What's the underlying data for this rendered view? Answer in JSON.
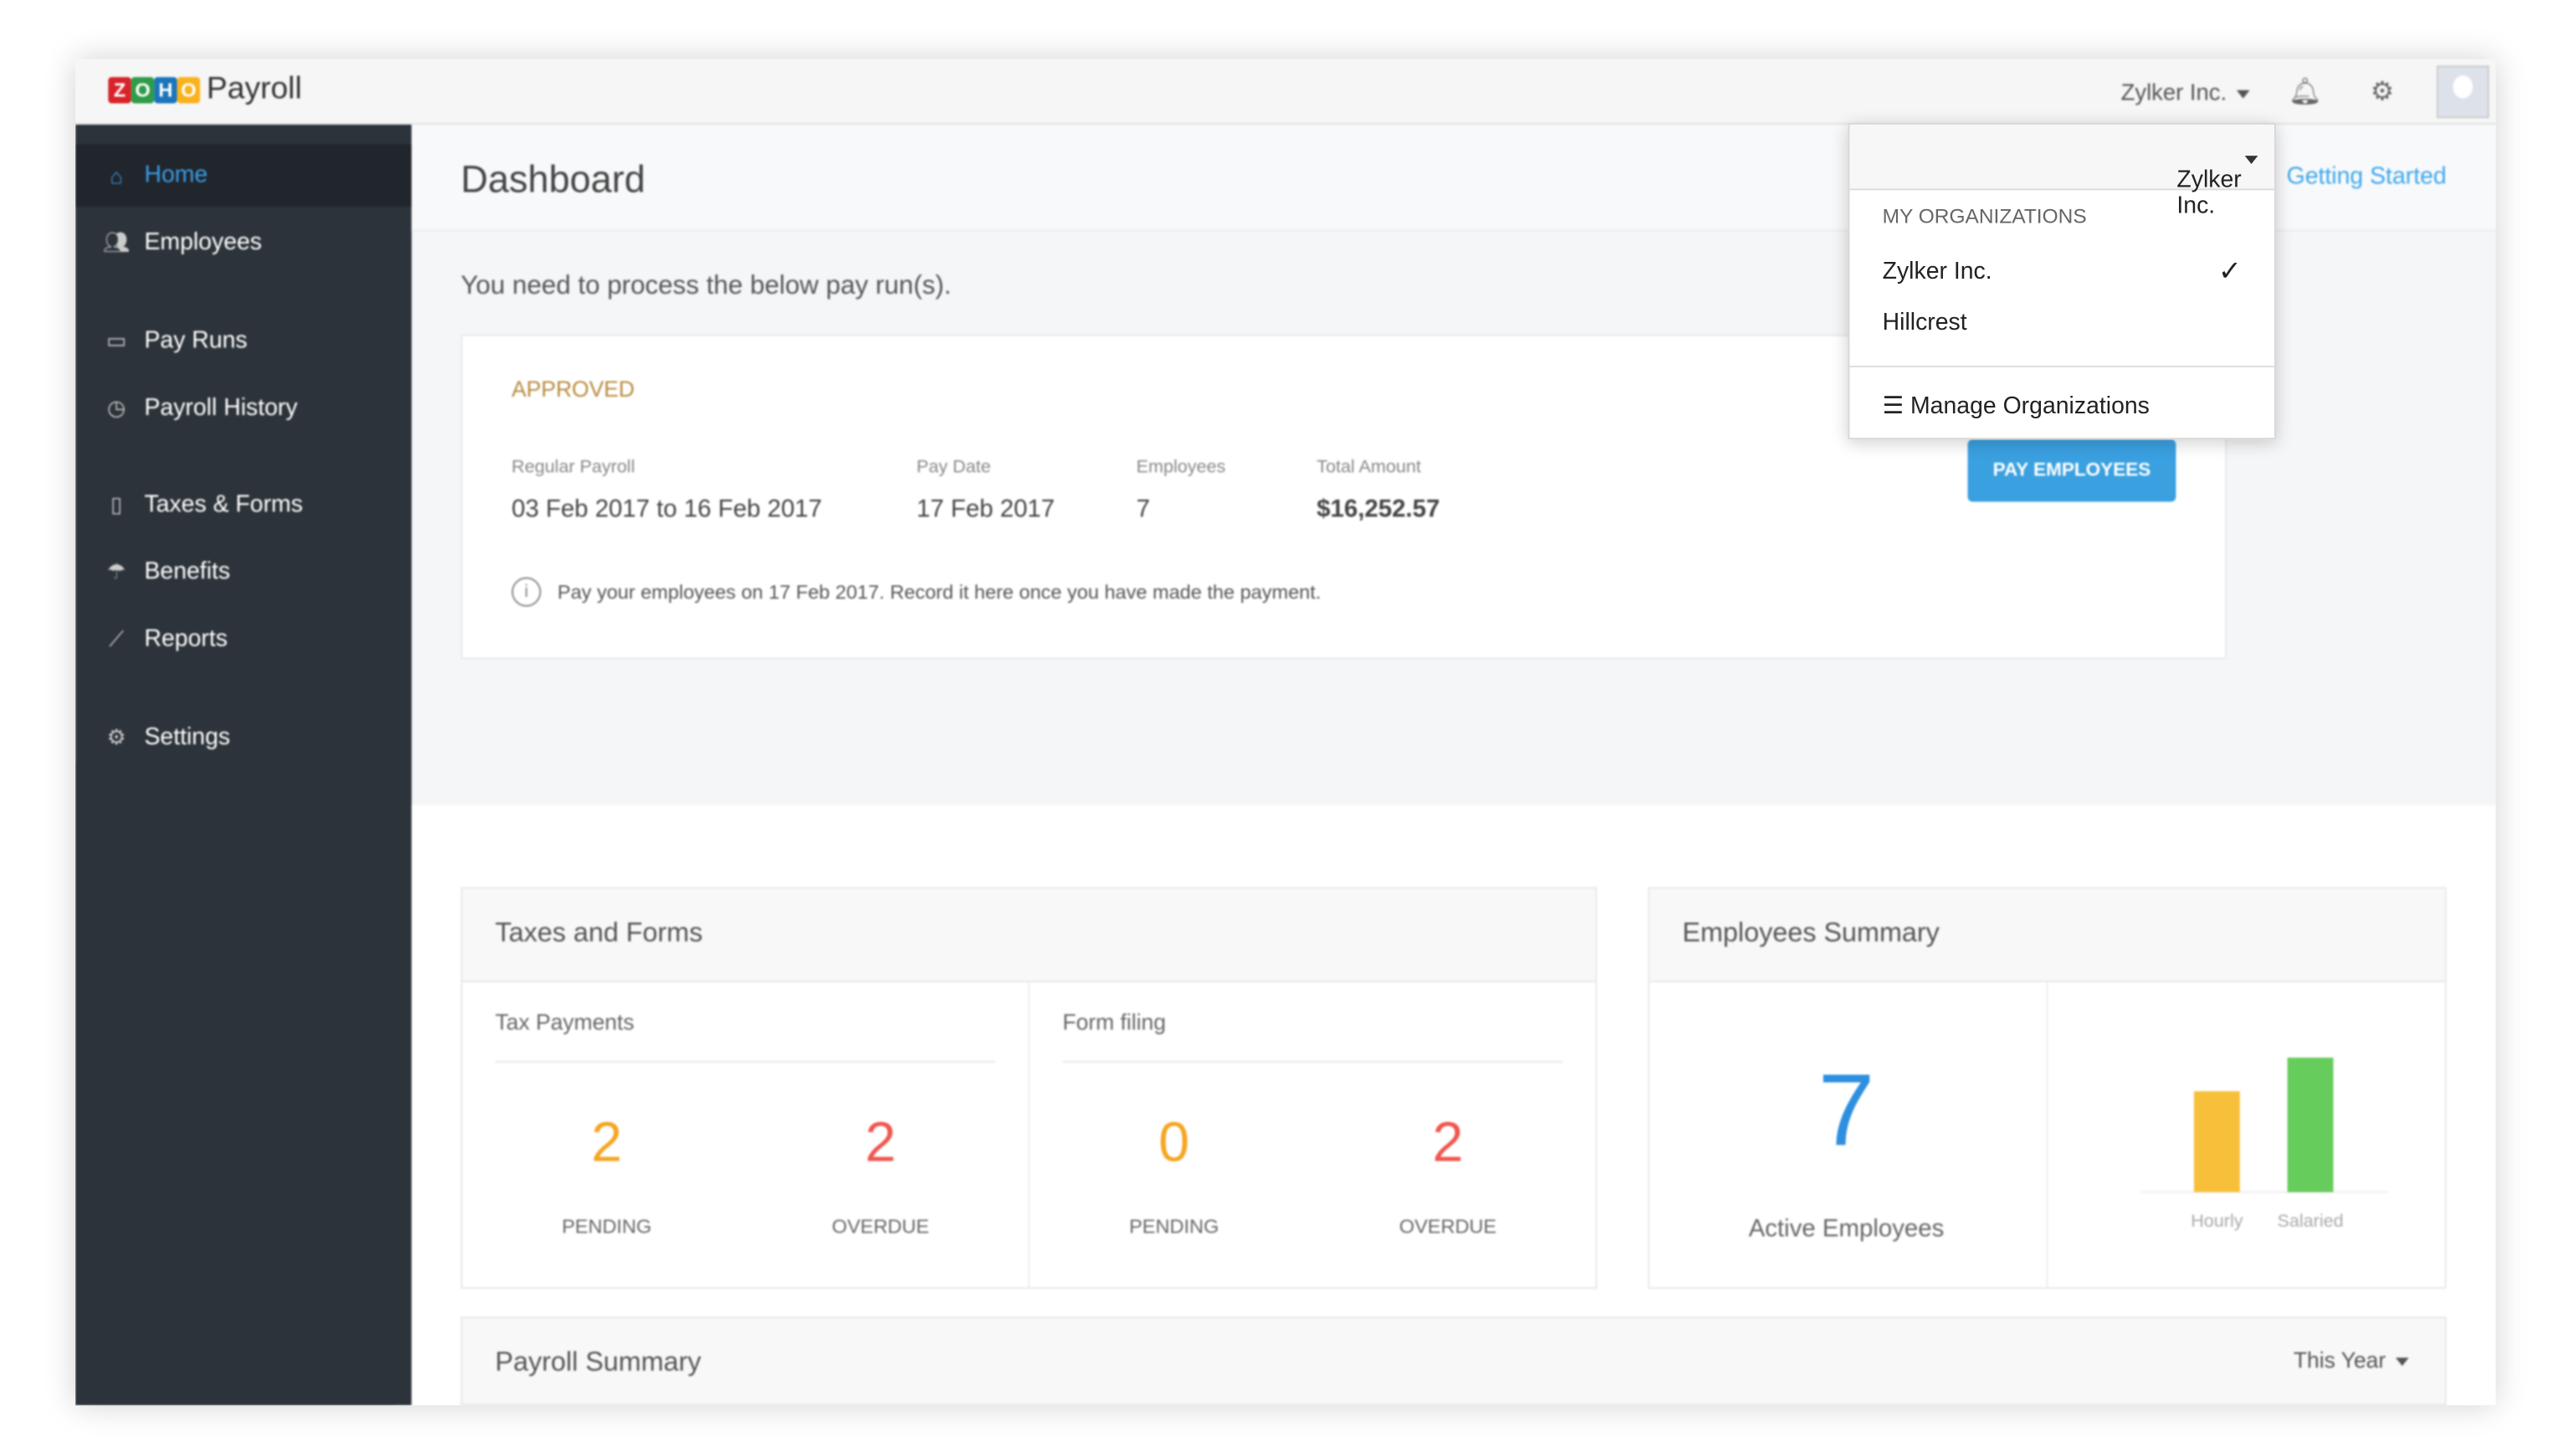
{
  "app": {
    "brand_letters": [
      "Z",
      "O",
      "H",
      "O"
    ],
    "brand_colors": [
      "#d8232a",
      "#2e9c48",
      "#1b75bb",
      "#f9b21d"
    ],
    "title": "Payroll",
    "org": "Zylker Inc."
  },
  "topbar": {
    "bell_icon": "bell-icon",
    "gear_icon": "gear-icon"
  },
  "sidebar": {
    "items": [
      {
        "label": "Home",
        "icon": "home-icon",
        "active": true
      },
      {
        "label": "Employees",
        "icon": "users-icon"
      },
      {
        "label": "Pay Runs",
        "icon": "calendar-icon"
      },
      {
        "label": "Payroll History",
        "icon": "clock-icon"
      },
      {
        "label": "Taxes & Forms",
        "icon": "document-icon"
      },
      {
        "label": "Benefits",
        "icon": "umbrella-icon"
      },
      {
        "label": "Reports",
        "icon": "chart-icon"
      },
      {
        "label": "Settings",
        "icon": "gear-icon"
      }
    ]
  },
  "header": {
    "title": "Dashboard",
    "getting_started": "Getting Started"
  },
  "payrun": {
    "prompt": "You need to process the below pay run(s).",
    "status": "APPROVED",
    "fields": [
      {
        "label": "Regular Payroll",
        "value": "03 Feb 2017 to 16 Feb 2017"
      },
      {
        "label": "Pay Date",
        "value": "17 Feb 2017"
      },
      {
        "label": "Employees",
        "value": "7"
      },
      {
        "label": "Total Amount",
        "value": "$16,252.57"
      }
    ],
    "button": "PAY EMPLOYEES",
    "note": "Pay your employees on 17 Feb 2017. Record it here once you have made the payment."
  },
  "taxes": {
    "title": "Taxes and Forms",
    "tax_payments": {
      "label": "Tax Payments",
      "pending": "2",
      "overdue": "2"
    },
    "form_filing": {
      "label": "Form filing",
      "pending": "0",
      "overdue": "2"
    },
    "pending_label": "PENDING",
    "overdue_label": "OVERDUE"
  },
  "employees_summary": {
    "title": "Employees Summary",
    "count": "7",
    "count_label": "Active Employees"
  },
  "chart_data": {
    "type": "bar",
    "categories": [
      "Hourly",
      "Salaried"
    ],
    "values": [
      3,
      4
    ],
    "colors": [
      "#f8c03a",
      "#66cc5c"
    ]
  },
  "payroll_summary": {
    "title": "Payroll Summary",
    "period": "This Year"
  },
  "org_dropdown": {
    "current": "Zylker Inc.",
    "section": "MY ORGANIZATIONS",
    "orgs": [
      {
        "name": "Zylker Inc.",
        "selected": true
      },
      {
        "name": "Hillcrest"
      }
    ],
    "manage": "Manage Organizations"
  }
}
